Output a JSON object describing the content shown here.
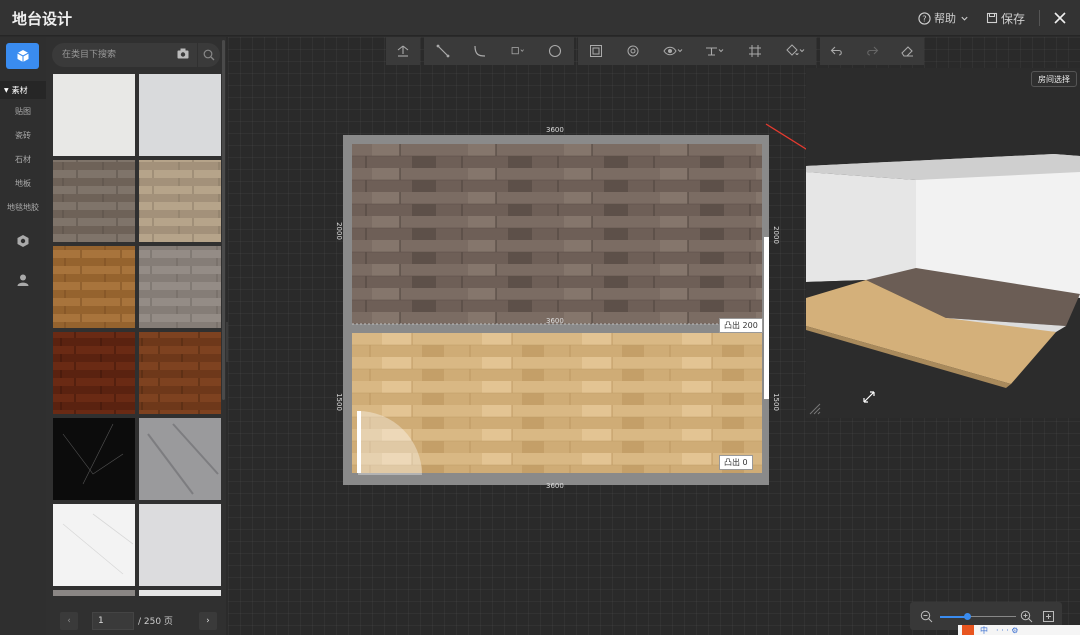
{
  "header": {
    "title": "地台设计",
    "help_label": "帮助",
    "save_label": "保存"
  },
  "rail": {
    "category_header": "素材",
    "categories": [
      "贴图",
      "瓷砖",
      "石材",
      "地板",
      "地毯地胶"
    ]
  },
  "search": {
    "placeholder": "在类目下搜索"
  },
  "pager": {
    "current_page": "1",
    "total": "/ 250 页"
  },
  "plan": {
    "dim_top": "3600",
    "dim_bottom": "3600",
    "dim_mid": "3600",
    "dim_left_upper": "2000",
    "dim_left_lower": "1500",
    "dim_right_upper": "2000",
    "dim_right_lower": "1500",
    "tag_upper": "凸出 200",
    "tag_lower": "凸出 0"
  },
  "preview": {
    "room_select_label": "房间选择"
  },
  "ime": {
    "label": "中"
  },
  "colors": {
    "accent": "#3a8cf0",
    "arrow": "#e53a2f",
    "ime_badge": "#e8551f"
  }
}
